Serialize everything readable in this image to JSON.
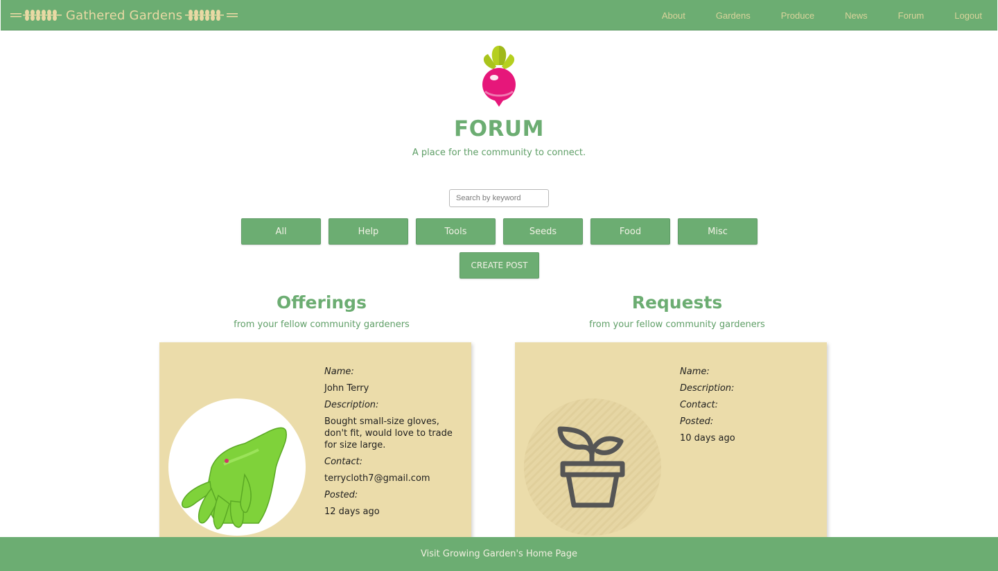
{
  "brand": {
    "title": "Gathered Gardens"
  },
  "nav": {
    "items": [
      "About",
      "Gardens",
      "Produce",
      "News",
      "Forum",
      "Logout"
    ]
  },
  "hero": {
    "title": "FORUM",
    "subtitle": "A place for the community to connect."
  },
  "search": {
    "placeholder": "Search by keyword",
    "value": ""
  },
  "filters": [
    "All",
    "Help",
    "Tools",
    "Seeds",
    "Food",
    "Misc"
  ],
  "create_post_label": "CREATE POST",
  "offerings": {
    "title": "Offerings",
    "subtitle": "from your fellow community gardeners",
    "card": {
      "name_label": "Name:",
      "name": "John Terry",
      "description_label": "Description:",
      "description": "Bought small-size gloves, don't fit, would love to trade for size large.",
      "contact_label": "Contact:",
      "contact": "terrycloth7@gmail.com",
      "posted_label": "Posted:",
      "posted": "12 days ago",
      "image_icon": "green-glove"
    }
  },
  "requests": {
    "title": "Requests",
    "subtitle": "from your fellow community gardeners",
    "card": {
      "name_label": "Name:",
      "description_label": "Description:",
      "contact_label": "Contact:",
      "posted_label": "Posted:",
      "posted": "10 days ago",
      "image_icon": "potted-sprout-icon"
    }
  },
  "footer": {
    "link": "Visit Growing Garden's Home Page"
  },
  "colors": {
    "primary_green": "#6cad72",
    "card_tan": "#ebdcaa",
    "brand_text": "#e9d9a4",
    "radish_pink": "#e6177a",
    "leaf_green": "#b5cf1f"
  }
}
